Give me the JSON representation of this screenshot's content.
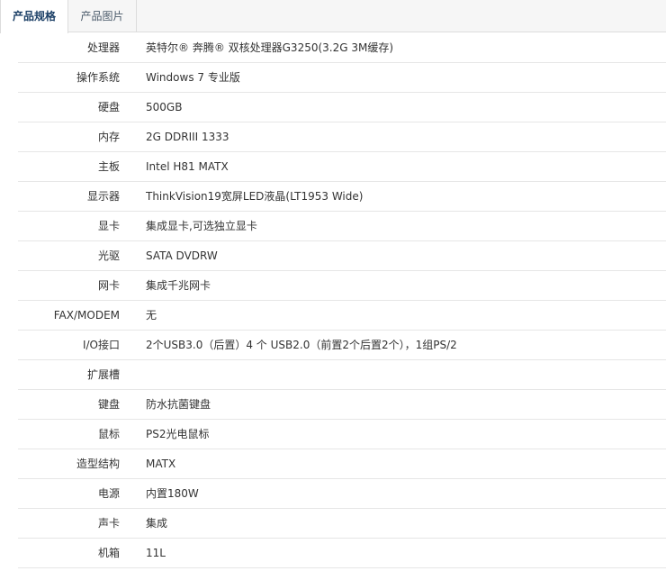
{
  "tabs": [
    {
      "label": "产品规格",
      "active": true
    },
    {
      "label": "产品图片",
      "active": false
    }
  ],
  "specs": [
    {
      "label": "处理器",
      "value": "英特尔® 奔腾® 双核处理器G3250(3.2G 3M缓存)"
    },
    {
      "label": "操作系统",
      "value": "Windows 7 专业版"
    },
    {
      "label": "硬盘",
      "value": "500GB"
    },
    {
      "label": "内存",
      "value": "2G DDRIII 1333"
    },
    {
      "label": "主板",
      "value": "Intel H81 MATX"
    },
    {
      "label": "显示器",
      "value": "ThinkVision19宽屏LED液晶(LT1953 Wide)"
    },
    {
      "label": "显卡",
      "value": "集成显卡,可选独立显卡"
    },
    {
      "label": "光驱",
      "value": "SATA DVDRW"
    },
    {
      "label": "网卡",
      "value": "集成千兆网卡"
    },
    {
      "label": "FAX/MODEM",
      "value": "无"
    },
    {
      "label": "I/O接口",
      "value": "2个USB3.0（后置）4 个 USB2.0（前置2个后置2个），1组PS/2"
    },
    {
      "label": "扩展槽",
      "value": ""
    },
    {
      "label": "键盘",
      "value": "防水抗菌键盘"
    },
    {
      "label": "鼠标",
      "value": "PS2光电鼠标"
    },
    {
      "label": "造型结构",
      "value": "MATX"
    },
    {
      "label": "电源",
      "value": "内置180W"
    },
    {
      "label": "声卡",
      "value": "集成"
    },
    {
      "label": "机箱",
      "value": "11L"
    }
  ]
}
